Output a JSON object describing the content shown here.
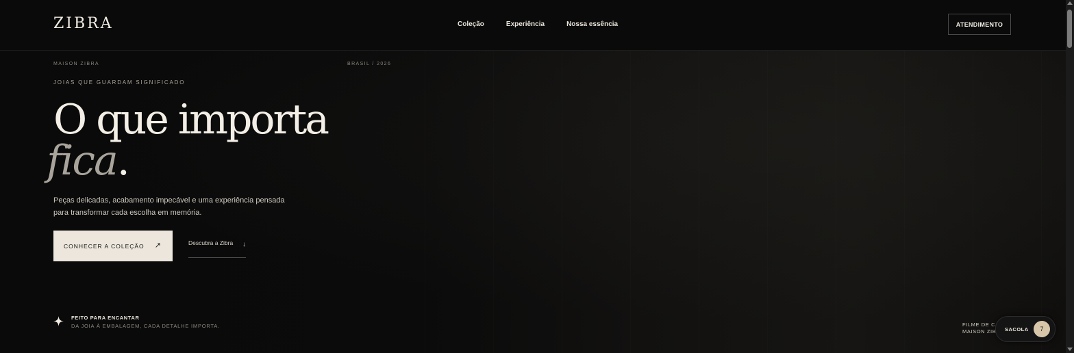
{
  "header": {
    "logo": "ZIBRA",
    "nav": [
      "Coleção",
      "Experiência",
      "Nossa essência"
    ],
    "cta": "ATENDIMENTO"
  },
  "hero": {
    "meta_left": "MAISON ZIBRA",
    "meta_right": "BRASIL / 2026",
    "eyebrow": "JOIAS QUE GUARDAM SIGNIFICADO",
    "title_line1": "O que importa",
    "title_italic": "fica",
    "title_dot": ".",
    "lead": "Peças delicadas, acabamento impecável e uma experiência pensada para transformar cada escolha em memória.",
    "primary_button": "CONHECER A COLEÇÃO",
    "primary_arrow": "↗",
    "secondary_link": "Descubra a Zibra",
    "secondary_arrow": "↓"
  },
  "feature": {
    "icon": "sparkle-icon",
    "title": "FEITO PARA ENCANTAR",
    "subtitle": "DA JOIA À EMBALAGEM, CADA DETALHE IMPORTA."
  },
  "film": {
    "line1": "FILME DE CAMPANHA",
    "line2": "MAISON ZIBRA"
  },
  "bag": {
    "label": "SACOLA",
    "count": "7"
  },
  "colors": {
    "background": "#0b0b0b",
    "text": "#e9e4da",
    "accent_button": "#ece6dc",
    "badge": "#d8c6a8"
  }
}
